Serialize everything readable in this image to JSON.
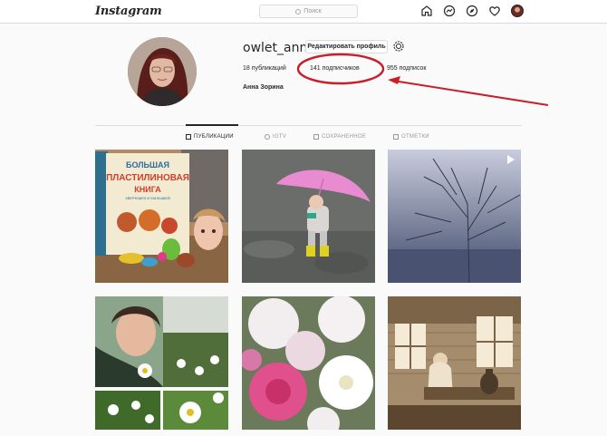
{
  "nav": {
    "logo": "Instagram",
    "search_placeholder": "Поиск",
    "icons": [
      "home-icon",
      "messenger-icon",
      "compass-icon",
      "heart-icon",
      "profile-avatar"
    ]
  },
  "profile": {
    "username": "owlet_ann",
    "edit_button": "Редактировать профиль",
    "posts": "18 публикаций",
    "followers": "141 подписчиков",
    "following": "955 подписок",
    "full_name": "Анна Зорина"
  },
  "tabs": [
    {
      "label": "ПУБЛИКАЦИИ",
      "icon": "grid-icon",
      "active": true
    },
    {
      "label": "IGTV",
      "icon": "igtv-icon",
      "active": false
    },
    {
      "label": "СОХРАНЕННОЕ",
      "icon": "bookmark-icon",
      "active": false
    },
    {
      "label": "ОТМЕТКИ",
      "icon": "tag-icon",
      "active": false
    }
  ],
  "posts_grid": {
    "book_cover": {
      "line1": "БОЛЬШАЯ",
      "line2": "ПЛАСТИЛИНОВАЯ",
      "line3": "КНИГА",
      "line4": "ЗВЕРЮШЕК И МАЛЫШЕЙ"
    }
  },
  "colors": {
    "annotation_red": "#c8202a",
    "umbrella_pink": "#e88bd0",
    "border": "#dbdbdb",
    "background": "#fafafa"
  }
}
